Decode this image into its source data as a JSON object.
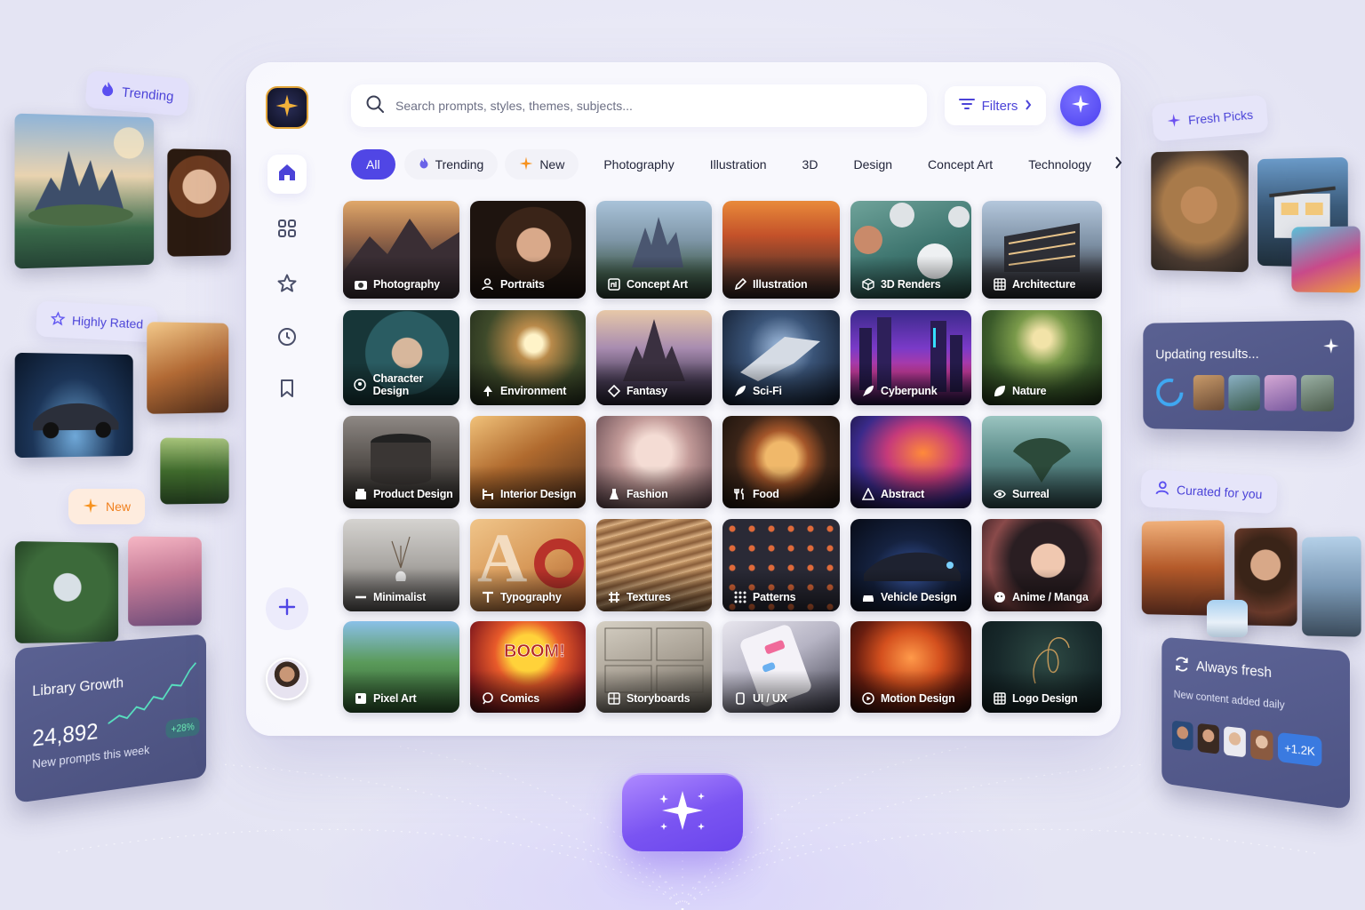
{
  "search": {
    "placeholder": "Search prompts, styles, themes, subjects..."
  },
  "toolbar": {
    "filters_label": "Filters"
  },
  "sidebar": {
    "items": [
      {
        "icon": "home-icon"
      },
      {
        "icon": "grid-icon"
      },
      {
        "icon": "star-icon"
      },
      {
        "icon": "clock-icon"
      },
      {
        "icon": "bookmark-icon"
      }
    ]
  },
  "chips": {
    "all": "All",
    "trending": "Trending",
    "new": "New",
    "photography": "Photography",
    "illustration": "Illustration",
    "three_d": "3D",
    "design": "Design",
    "concept_art": "Concept Art",
    "technology": "Technology"
  },
  "categories": [
    "Photography",
    "Portraits",
    "Concept Art",
    "Illustration",
    "3D Renders",
    "Architecture",
    "Character Design",
    "Environment",
    "Fantasy",
    "Sci-Fi",
    "Cyberpunk",
    "Nature",
    "Product Design",
    "Interior Design",
    "Fashion",
    "Food",
    "Abstract",
    "Surreal",
    "Minimalist",
    "Typography",
    "Textures",
    "Patterns",
    "Vehicle Design",
    "Anime / Manga",
    "Pixel Art",
    "Comics",
    "Storyboards",
    "UI / UX",
    "Motion Design",
    "Logo Design"
  ],
  "left": {
    "trending": "Trending",
    "highly_rated": "Highly Rated",
    "new": "New",
    "library": {
      "title": "Library Growth",
      "count": "24,892",
      "subtitle": "New prompts this week",
      "badge": "+28%"
    }
  },
  "right": {
    "fresh_picks": "Fresh Picks",
    "updating": "Updating results...",
    "curated": "Curated for you",
    "always_fresh": {
      "title": "Always fresh",
      "subtitle": "New content added daily",
      "badge": "+1.2K"
    }
  },
  "colors": {
    "accent": "#5046e5",
    "card": "#5a6192",
    "badge_green": "#6ef0b8"
  }
}
